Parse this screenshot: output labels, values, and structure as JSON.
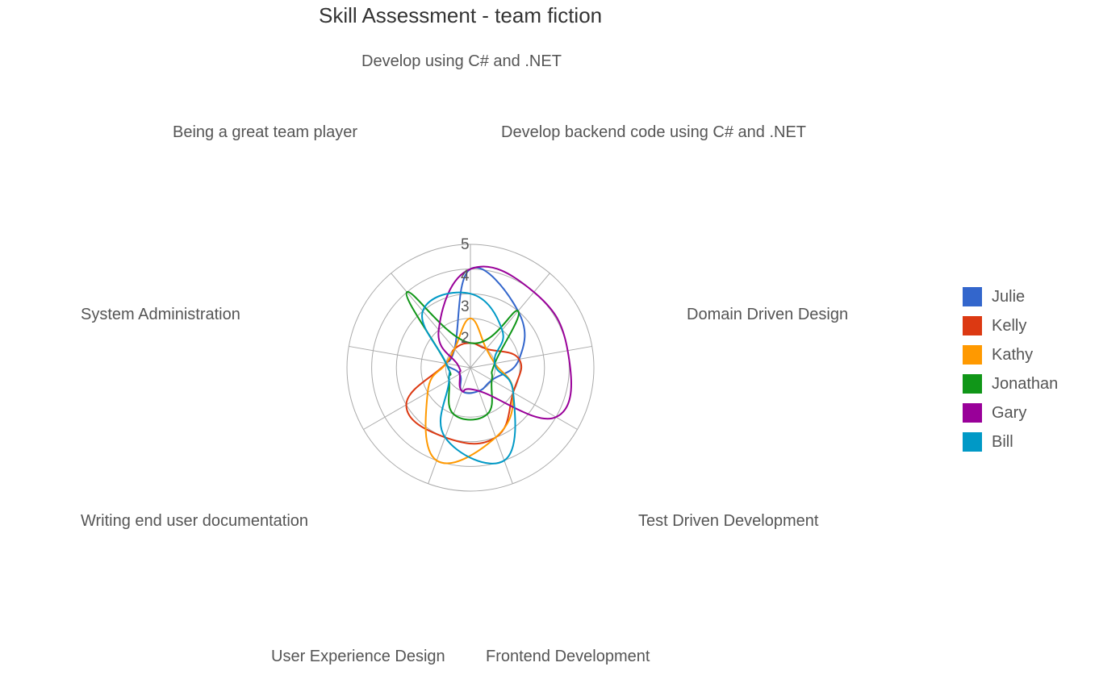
{
  "chart_data": {
    "type": "radar",
    "title": "Skill Assessment - team fiction",
    "axes": [
      "Develop using C# and .NET",
      "Develop backend code using C# and .NET",
      "Domain Driven Design",
      "Test Driven Development",
      "Frontend Development",
      "User Experience Design",
      "Writing end user documentation",
      "System Administration",
      "Being a great team player"
    ],
    "rlim": [
      0,
      5
    ],
    "ticks": [
      "2",
      "3",
      "4",
      "5"
    ],
    "grid": true,
    "legend_position": "right",
    "series": [
      {
        "name": "Julie",
        "color": "#3366cc",
        "values": [
          4,
          3,
          2,
          1,
          1,
          1,
          0.5,
          1,
          1
        ]
      },
      {
        "name": "Kelly",
        "color": "#dc3912",
        "values": [
          1,
          1,
          2,
          2,
          3,
          3,
          3,
          1,
          1
        ]
      },
      {
        "name": "Kathy",
        "color": "#ff9900",
        "values": [
          2,
          1,
          1,
          2,
          3,
          4,
          2,
          1,
          1
        ]
      },
      {
        "name": "Jonathan",
        "color": "#109618",
        "values": [
          1,
          3,
          1,
          1,
          2,
          2,
          1,
          1,
          4
        ]
      },
      {
        "name": "Gary",
        "color": "#990099",
        "values": [
          4,
          4,
          4,
          4,
          1,
          1,
          0.5,
          0.5,
          2
        ]
      },
      {
        "name": "Bill",
        "color": "#0099c6",
        "values": [
          3,
          2,
          1,
          2,
          4,
          3,
          1,
          1,
          3
        ]
      }
    ]
  }
}
